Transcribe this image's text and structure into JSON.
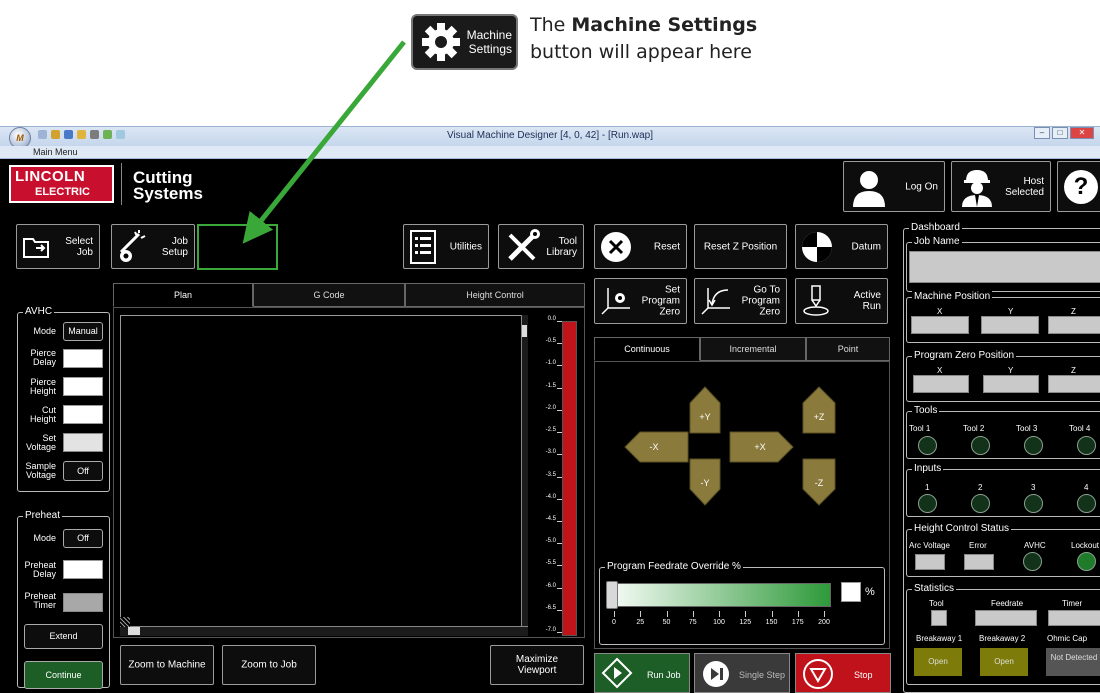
{
  "callout": {
    "button_line1": "Machine",
    "button_line2": "Settings",
    "text_prefix": "The ",
    "text_bold": "Machine Settings",
    "text_line2": "button will appear here"
  },
  "window": {
    "title": "Visual Machine Designer [4, 0, 42] - [Run.wap]",
    "menu": "Main Menu",
    "orb_label": "M"
  },
  "header": {
    "logo_line1": "LINCOLN",
    "logo_line2": "ELECTRIC",
    "brand_line1": "Cutting",
    "brand_line2": "Systems",
    "log_on": "Log On",
    "host_line1": "Host",
    "host_line2": "Selected",
    "help": "?"
  },
  "toolbar": {
    "select_job_1": "Select",
    "select_job_2": "Job",
    "job_setup_1": "Job",
    "job_setup_2": "Setup",
    "utilities": "Utilities",
    "tool_library_1": "Tool",
    "tool_library_2": "Library",
    "reset": "Reset",
    "reset_z": "Reset Z Position",
    "datum": "Datum",
    "set_zero_1": "Set",
    "set_zero_2": "Program",
    "set_zero_3": "Zero",
    "goto_zero_1": "Go To",
    "goto_zero_2": "Program",
    "goto_zero_3": "Zero",
    "active_run_1": "Active",
    "active_run_2": "Run"
  },
  "avhc": {
    "title": "AVHC",
    "mode_label": "Mode",
    "mode_value": "Manual",
    "pierce_delay_1": "Pierce",
    "pierce_delay_2": "Delay",
    "pierce_height_1": "Pierce",
    "pierce_height_2": "Height",
    "cut_height_1": "Cut",
    "cut_height_2": "Height",
    "set_voltage_1": "Set",
    "set_voltage_2": "Voltage",
    "sample_voltage_1": "Sample",
    "sample_voltage_2": "Voltage",
    "sample_value": "Off"
  },
  "preheat": {
    "title": "Preheat",
    "mode_label": "Mode",
    "mode_value": "Off",
    "delay_1": "Preheat",
    "delay_2": "Delay",
    "timer_1": "Preheat",
    "timer_2": "Timer",
    "extend": "Extend",
    "continue": "Continue"
  },
  "view_tabs": [
    "Plan",
    "G Code",
    "Height Control"
  ],
  "scale_ticks": [
    "0.0",
    "-0.5",
    "-1.0",
    "-1.5",
    "-2.0",
    "-2.5",
    "-3.0",
    "-3.5",
    "-4.0",
    "-4.5",
    "-5.0",
    "-5.5",
    "-6.0",
    "-6.5",
    "-7.0"
  ],
  "viewport_buttons": {
    "zoom_machine": "Zoom to Machine",
    "zoom_job": "Zoom to Job",
    "maximize_1": "Maximize",
    "maximize_2": "Viewport"
  },
  "jog_tabs": [
    "Continuous",
    "Incremental",
    "Point"
  ],
  "jog": {
    "plus_y": "+Y",
    "minus_y": "-Y",
    "minus_x": "-X",
    "plus_x": "+X",
    "plus_z": "+Z",
    "minus_z": "-Z"
  },
  "feedrate": {
    "title": "Program Feedrate Override %",
    "percent": "%",
    "ticks": [
      "0",
      "25",
      "50",
      "75",
      "100",
      "125",
      "150",
      "175",
      "200"
    ]
  },
  "run": {
    "run_job": "Run Job",
    "single_step": "Single Step",
    "stop": "Stop"
  },
  "dashboard": {
    "title": "Dashboard",
    "job_name": "Job Name",
    "machine_position": "Machine Position",
    "program_zero": "Program Zero Position",
    "axes": [
      "X",
      "Y",
      "Z"
    ],
    "tools_title": "Tools",
    "tools": [
      "Tool 1",
      "Tool 2",
      "Tool 3",
      "Tool 4"
    ],
    "inputs_title": "Inputs",
    "inputs": [
      "1",
      "2",
      "3",
      "4"
    ],
    "hc_status": "Height Control Status",
    "hc_labels": [
      "Arc Voltage",
      "Error",
      "AVHC",
      "Lockout"
    ],
    "statistics": "Statistics",
    "stat_labels": [
      "Tool",
      "Feedrate",
      "Timer"
    ],
    "breakaway_labels": [
      "Breakaway 1",
      "Breakaway 2",
      "Ohmic Cap"
    ],
    "breakaway_values": [
      "Open",
      "Open",
      "Not Detected"
    ]
  },
  "colors": {
    "accent_green": "#3aa93a",
    "jog_pad": "#8a7a3c",
    "stop_red": "#c0121a",
    "run_green": "#1d5e27",
    "open_yellow": "#7d7c0a"
  }
}
